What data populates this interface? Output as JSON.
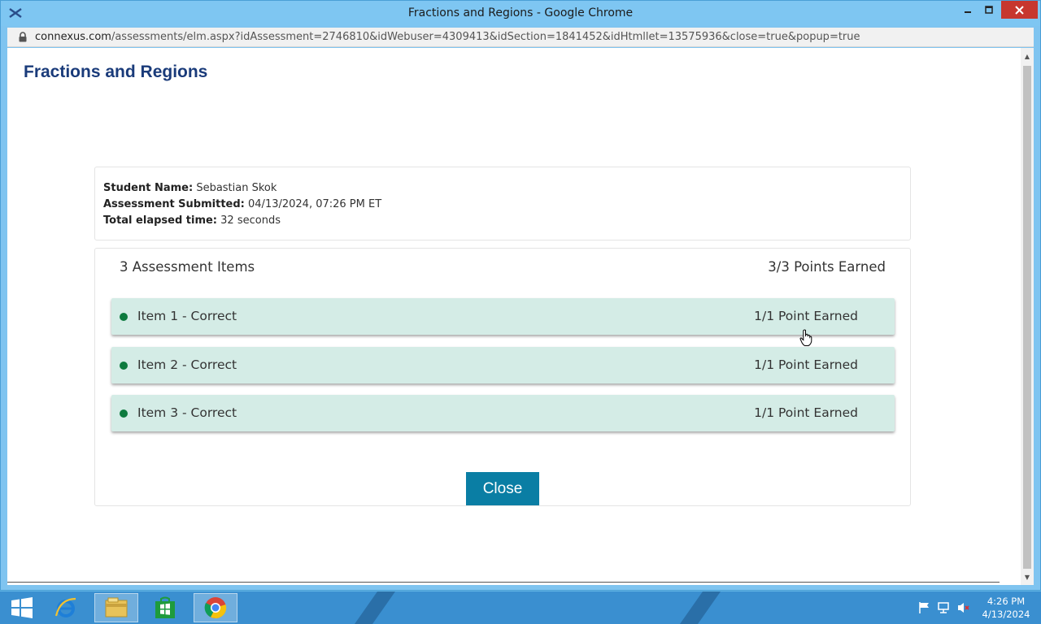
{
  "window": {
    "title": "Fractions and Regions - Google Chrome",
    "url_host": "connexus.com",
    "url_path": "/assessments/elm.aspx?idAssessment=2746810&idWebuser=4309413&idSection=1841452&idHtmllet=13575936&close=true&popup=true"
  },
  "page": {
    "title": "Fractions and Regions"
  },
  "info": {
    "student_label": "Student Name:",
    "student_value": "Sebastian Skok",
    "submitted_label": "Assessment Submitted:",
    "submitted_value": "04/13/2024, 07:26 PM ET",
    "elapsed_label": "Total elapsed time:",
    "elapsed_value": "32 seconds"
  },
  "assessment": {
    "items_count_label": "3 Assessment Items",
    "points_total_label": "3/3 Points Earned",
    "items": [
      {
        "label": "Item 1 - Correct",
        "points": "1/1 Point Earned"
      },
      {
        "label": "Item 2 - Correct",
        "points": "1/1 Point Earned"
      },
      {
        "label": "Item 3 - Correct",
        "points": "1/1 Point Earned"
      }
    ],
    "close_label": "Close"
  },
  "taskbar": {
    "apps": [
      "windows-start",
      "internet-explorer",
      "file-explorer",
      "windows-store",
      "google-chrome"
    ],
    "time": "4:26 PM",
    "date": "4/13/2024"
  },
  "colors": {
    "title_blue": "#1a3b7a",
    "item_bg": "#d4ece6",
    "correct_dot": "#0d7a3e",
    "close_button": "#0a7ea4",
    "titlebar": "#7ec6f2",
    "taskbar": "#3a8fd0"
  }
}
